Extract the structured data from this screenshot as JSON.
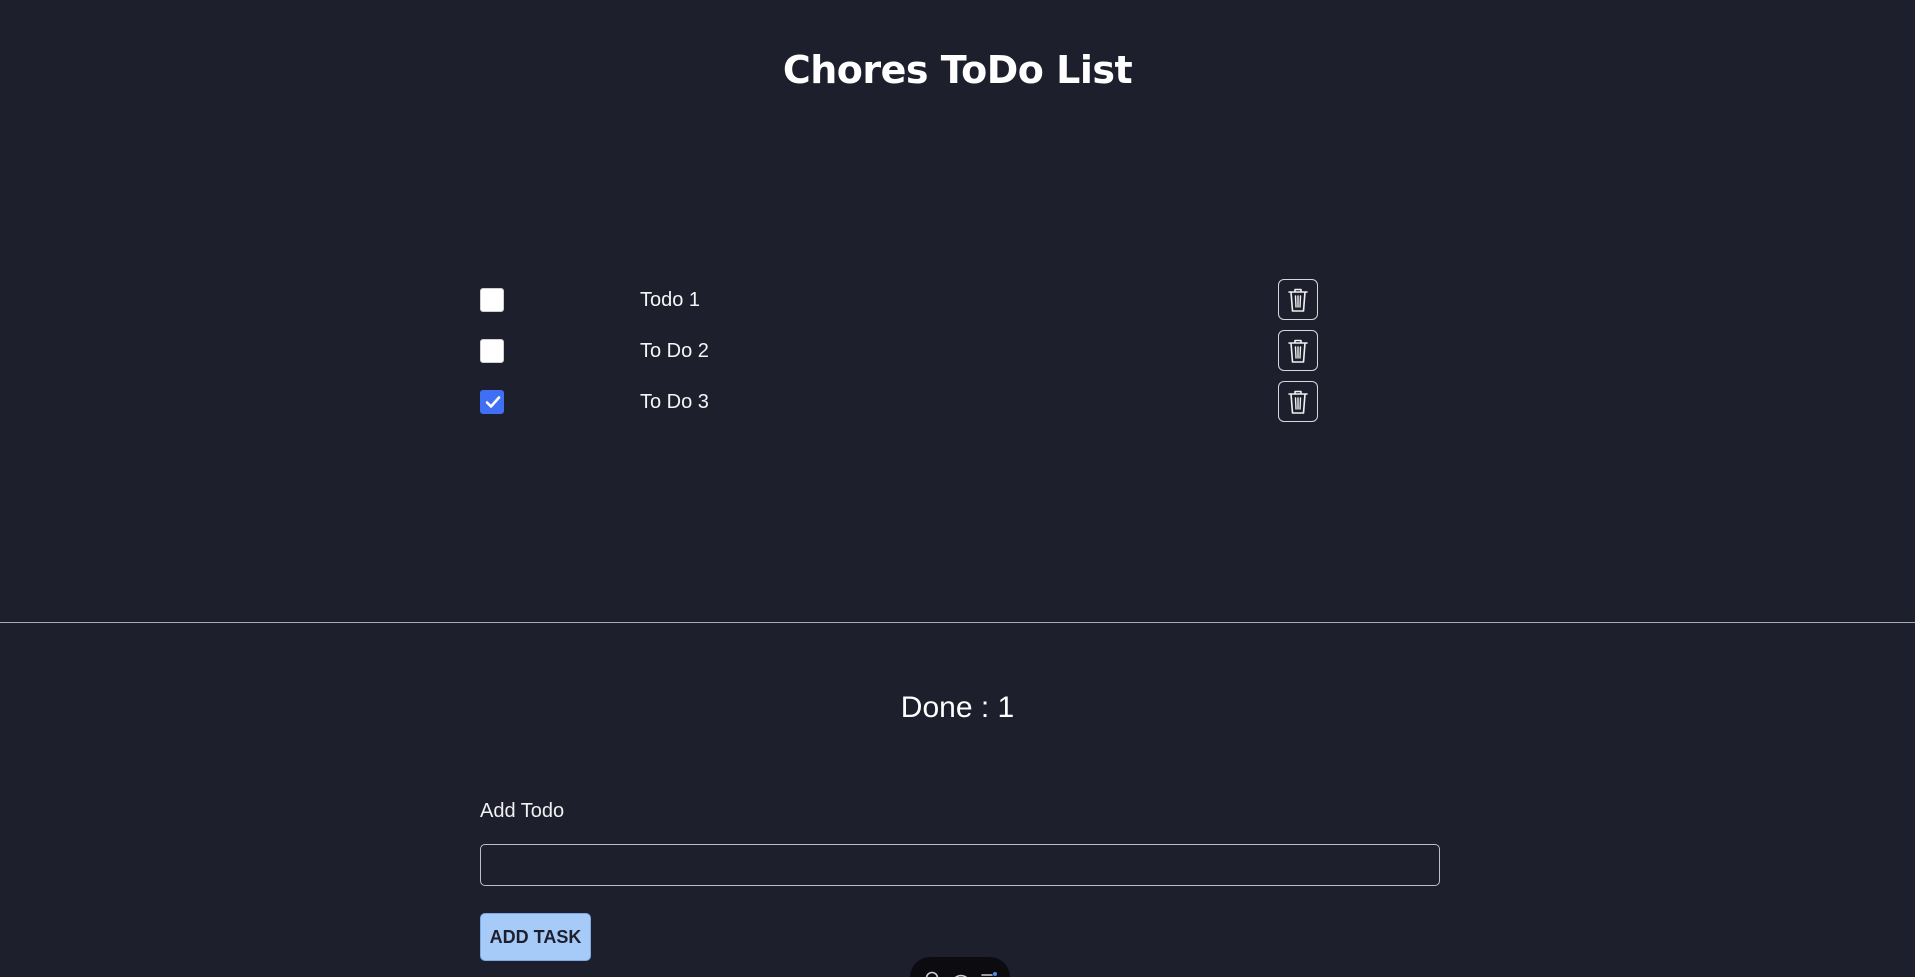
{
  "page": {
    "title": "Chores ToDo List"
  },
  "todos": [
    {
      "label": "Todo 1",
      "checked": false
    },
    {
      "label": "To Do 2",
      "checked": false
    },
    {
      "label": "To Do 3",
      "checked": true
    }
  ],
  "summary": {
    "done_text": "Done : 1"
  },
  "form": {
    "add_label": "Add Todo",
    "input_value": "",
    "button_label": "ADD TASK"
  },
  "icons": {
    "delete": "trash-icon",
    "check": "checkmark-icon"
  },
  "colors": {
    "background": "#1e1f2d",
    "checkbox_checked": "#3f6ff5",
    "add_button": "#a6cbf8"
  }
}
